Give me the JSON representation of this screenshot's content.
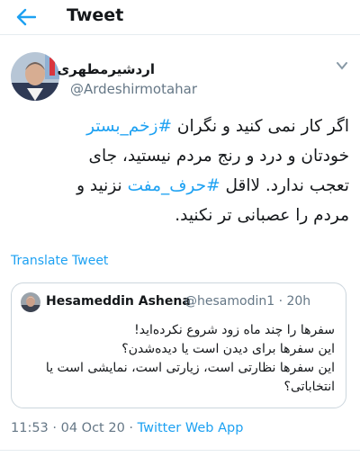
{
  "header": {
    "title": "Tweet"
  },
  "author": {
    "name": "اردشیرمطهری",
    "handle": "@Ardeshirmotahar"
  },
  "tweet": {
    "lines": [
      [
        "اگر کار نمی کنید و نگران ",
        "#زخم_بستر"
      ],
      [
        "خودتان و درد و رنج مردم نیستید، جای"
      ],
      [
        "تعجب ندارد. لااقل ",
        "#حرف_مفت",
        " نزنید و"
      ],
      [
        "مردم را عصبانی تر نکنید."
      ]
    ]
  },
  "translate_label": "Translate Tweet",
  "quoted": {
    "name": "Hesameddin Ashena",
    "handle": "@hesamodin1 · 20h",
    "lines": [
      "سفرها را چند ماه زود شروع نکرده‌اید!",
      "این سفرها برای دیدن است یا دیده‌شدن؟",
      "این سفرها نظارتی است، زیارتی است، نمایشی است یا",
      "انتخاباتی؟"
    ]
  },
  "meta": {
    "time_date": "11:53 · 04 Oct 20 · ",
    "app": "Twitter Web App"
  },
  "colors": {
    "accent": "#1da1f2",
    "muted": "#657786",
    "text": "#14171a",
    "border": "#ccd6dd"
  },
  "icons": [
    "back-arrow-icon",
    "caret-down-icon"
  ]
}
